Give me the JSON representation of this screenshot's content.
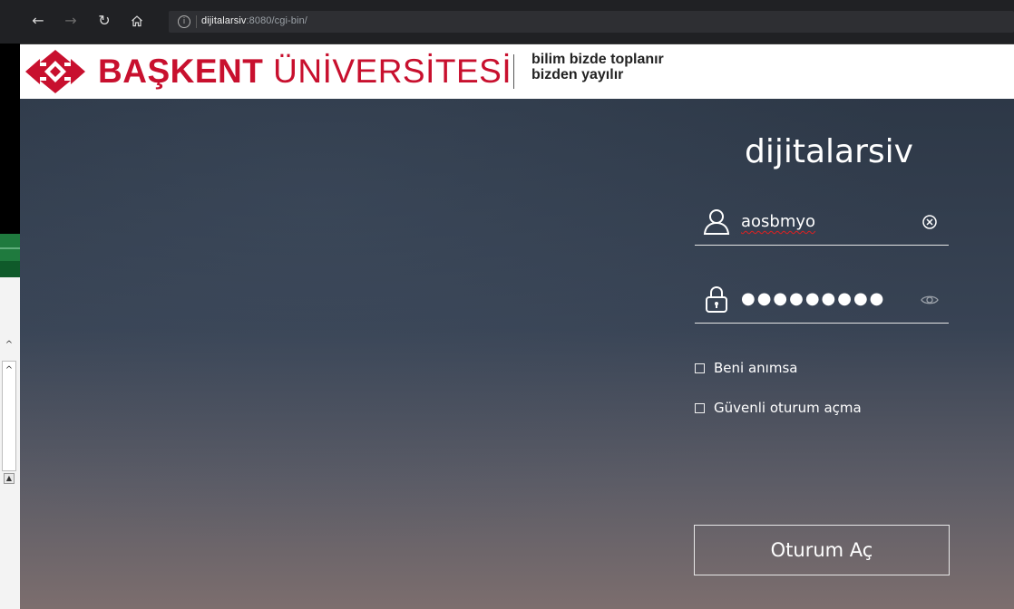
{
  "browser": {
    "url_host": "dijitalarsiv",
    "url_rest": ":8080/cgi-bin/",
    "nav_icons": [
      "back-icon",
      "forward-icon",
      "refresh-icon",
      "home-icon"
    ]
  },
  "header": {
    "brand_bold": "BAŞKENT",
    "brand_regular": " ÜNİVERSİTESİ",
    "slogan_line1": "bilim bizde toplanır",
    "slogan_line2": "bizden yayılır",
    "brand_color": "#c8102e"
  },
  "login": {
    "title": "dijitalarsiv",
    "username_value": "aosbmyo",
    "password_value": "●●●●●●●●●",
    "remember_label": "Beni anımsa",
    "secure_label": "Güvenli oturum açma",
    "submit_label": "Oturum Aç"
  }
}
